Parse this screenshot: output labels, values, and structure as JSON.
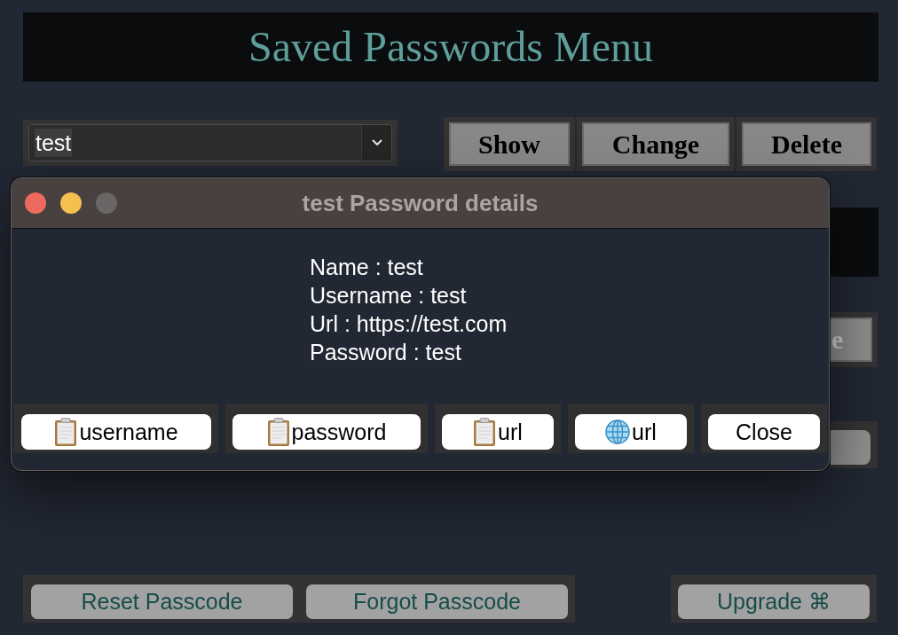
{
  "header": {
    "title": "Saved Passwords Menu"
  },
  "toolbar": {
    "selector": {
      "value": "test"
    },
    "buttons": [
      {
        "label": "Show"
      },
      {
        "label": "Change"
      },
      {
        "label": "Delete"
      }
    ]
  },
  "covered_controls": [
    {
      "kind": "panel"
    },
    {
      "kind": "button",
      "label": "e",
      "disabled": true
    },
    {
      "kind": "button"
    }
  ],
  "dialog": {
    "title": "test Password details",
    "window_buttons": [
      {
        "kind": "close",
        "disabled": false
      },
      {
        "kind": "minimize",
        "disabled": false
      },
      {
        "kind": "zoom",
        "disabled": true
      }
    ],
    "details": [
      "Name : test",
      "Username : test",
      "Url : https://test.com",
      "Password : test"
    ],
    "actions": [
      {
        "kind": "copy",
        "label": "username"
      },
      {
        "kind": "copy",
        "label": "password"
      },
      {
        "kind": "copy",
        "label": "url"
      },
      {
        "kind": "open",
        "label": "url"
      },
      {
        "kind": "plain",
        "label": "Close"
      }
    ]
  },
  "footer": {
    "left_buttons": [
      {
        "label": "Reset Passcode"
      },
      {
        "label": "Forgot Passcode"
      }
    ],
    "right_buttons": [
      {
        "label": "Upgrade ⌘"
      }
    ]
  }
}
